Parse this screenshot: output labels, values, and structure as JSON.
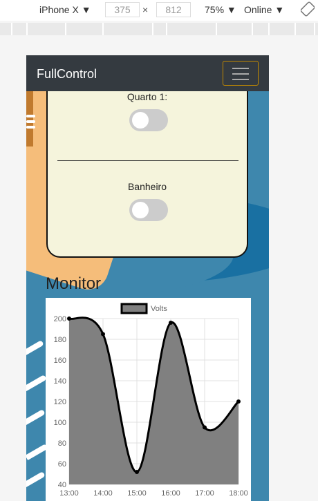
{
  "devtools": {
    "device": "iPhone X",
    "width": "375",
    "times": "×",
    "height": "812",
    "zoom": "75%",
    "network": "Online"
  },
  "navbar": {
    "brand": "FullControl"
  },
  "rooms": [
    {
      "label": "Quarto 1:",
      "on": false
    },
    {
      "label": "Banheiro",
      "on": false
    }
  ],
  "monitor": {
    "title": "Monitor"
  },
  "colors": {
    "navbar": "#343a40",
    "card": "#f5f4dc",
    "background": "#3e87ad",
    "series_fill": "#808080",
    "toggle_border": "#c38a00"
  },
  "chart_data": {
    "type": "area",
    "legend": [
      "Volts"
    ],
    "categories": [
      "13:00",
      "14:00",
      "15:00",
      "16:00",
      "17:00",
      "18:00"
    ],
    "series": [
      {
        "name": "Volts",
        "values": [
          200,
          185,
          52,
          196,
          95,
          120
        ]
      }
    ],
    "ylim": [
      40,
      200
    ],
    "yticks": [
      40,
      60,
      80,
      100,
      120,
      140,
      160,
      180,
      200
    ],
    "grid": true,
    "legend_position": "top"
  }
}
